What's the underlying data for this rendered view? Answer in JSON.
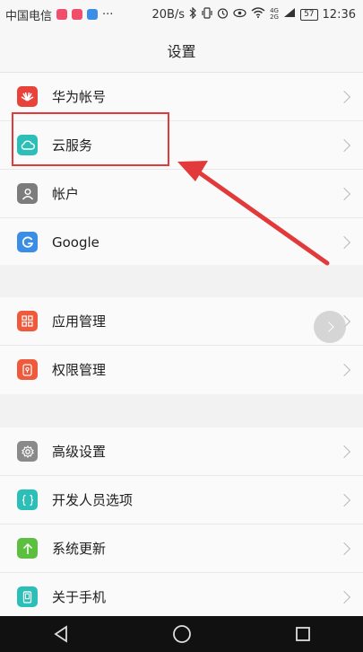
{
  "status_bar": {
    "carrier": "中国电信",
    "net_speed": "20B/s",
    "dots": "···",
    "network_type": "4G 2G",
    "battery": "57",
    "time": "12:36",
    "app_icon_colors": [
      "#f04e6a",
      "#f04e6a",
      "#3a8ee6"
    ]
  },
  "header": {
    "title": "设置"
  },
  "sections": [
    {
      "items": [
        {
          "label": "华为帐号",
          "icon": "huawei-icon",
          "color": "#e8433b"
        },
        {
          "label": "云服务",
          "icon": "cloud-icon",
          "color": "#2bbfb8"
        },
        {
          "label": "帐户",
          "icon": "person-icon",
          "color": "#7c7c7c"
        },
        {
          "label": "Google",
          "icon": "google-icon",
          "color": "#3a8ee6"
        }
      ]
    },
    {
      "items": [
        {
          "label": "应用管理",
          "icon": "grid-icon",
          "color": "#ef5a3c"
        },
        {
          "label": "权限管理",
          "icon": "shield-icon",
          "color": "#ef5a3c"
        }
      ]
    },
    {
      "items": [
        {
          "label": "高级设置",
          "icon": "gear-icon",
          "color": "#8a8a8a"
        },
        {
          "label": "开发人员选项",
          "icon": "braces-icon",
          "color": "#2bbfb8"
        },
        {
          "label": "系统更新",
          "icon": "update-icon",
          "color": "#5cbf3f"
        },
        {
          "label": "关于手机",
          "icon": "phone-icon",
          "color": "#2bbfb8"
        }
      ]
    }
  ],
  "annotation_color": "#e23a3a"
}
